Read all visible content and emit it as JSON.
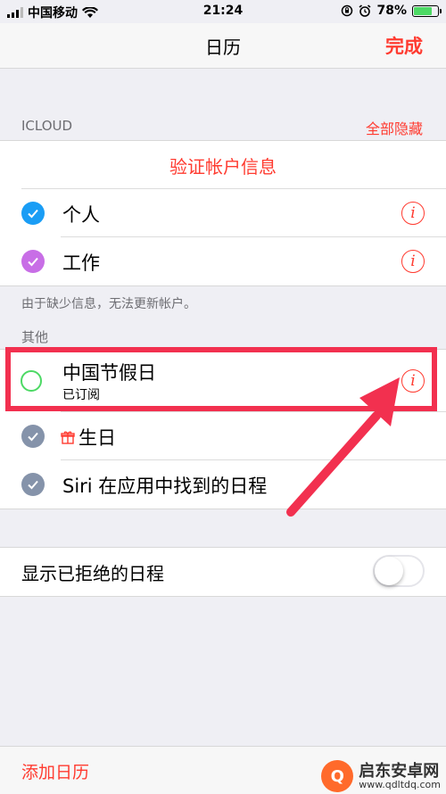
{
  "status_bar": {
    "carrier": "中国移动",
    "time": "21:24",
    "battery": "78%",
    "battery_level": 0.78
  },
  "nav": {
    "title": "日历",
    "done_label": "完成"
  },
  "icloud": {
    "header": "ICLOUD",
    "hide_all": "全部隐藏",
    "verify": "验证帐户信息",
    "calendars": [
      {
        "name": "个人",
        "color": "#1a9df5",
        "checked": true
      },
      {
        "name": "工作",
        "color": "#c86ee6",
        "checked": true
      }
    ],
    "note": "由于缺少信息，无法更新帐户。"
  },
  "other": {
    "header": "其他",
    "calendars": [
      {
        "name": "中国节假日",
        "subtitle": "已订阅",
        "color": "#4cd964",
        "checked": false
      },
      {
        "name": "生日",
        "color": "#8593aa",
        "checked": true,
        "icon": "gift-icon"
      },
      {
        "name": "Siri 在应用中找到的日程",
        "color": "#8593aa",
        "checked": true
      }
    ]
  },
  "settings": {
    "show_declined": "显示已拒绝的日程",
    "show_declined_on": false
  },
  "bottom": {
    "add_calendar": "添加日历"
  },
  "watermark": {
    "name": "启东安卓网",
    "url": "www.qdltdq.com"
  },
  "colors": {
    "accent": "#ff3b30",
    "annotation": "#f2304f"
  }
}
